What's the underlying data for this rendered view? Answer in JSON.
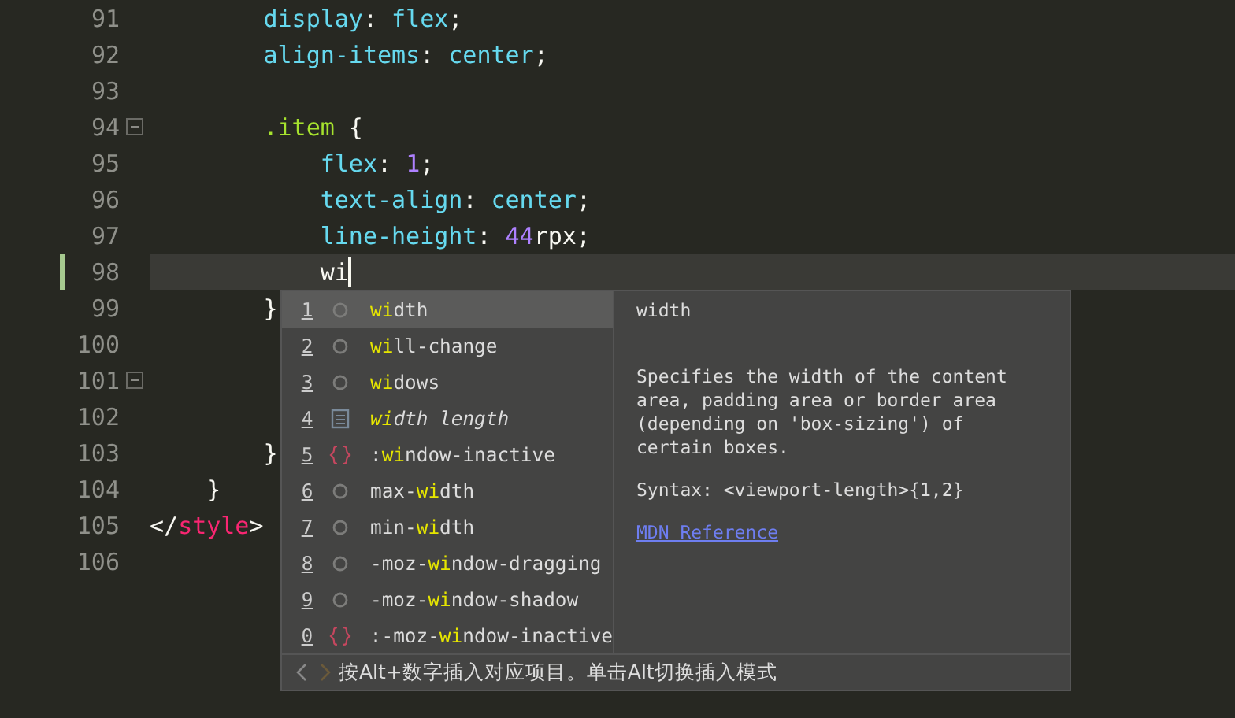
{
  "editor": {
    "lines": [
      {
        "number": "91",
        "fold": false,
        "current": false,
        "tokens": [
          {
            "text": "        display",
            "kind": "property"
          },
          {
            "text": ": ",
            "kind": "plain"
          },
          {
            "text": "flex",
            "kind": "value"
          },
          {
            "text": ";",
            "kind": "plain"
          }
        ]
      },
      {
        "number": "92",
        "fold": false,
        "current": false,
        "tokens": [
          {
            "text": "        align-items",
            "kind": "property"
          },
          {
            "text": ": ",
            "kind": "plain"
          },
          {
            "text": "center",
            "kind": "value"
          },
          {
            "text": ";",
            "kind": "plain"
          }
        ]
      },
      {
        "number": "93",
        "fold": false,
        "current": false
      },
      {
        "number": "94",
        "fold": true,
        "current": false,
        "tokens": [
          {
            "text": "        .item",
            "kind": "selector"
          },
          {
            "text": " {",
            "kind": "plain"
          }
        ]
      },
      {
        "number": "95",
        "fold": false,
        "current": false,
        "tokens": [
          {
            "text": "            flex",
            "kind": "property"
          },
          {
            "text": ": ",
            "kind": "plain"
          },
          {
            "text": "1",
            "kind": "number"
          },
          {
            "text": ";",
            "kind": "plain"
          }
        ]
      },
      {
        "number": "96",
        "fold": false,
        "current": false,
        "tokens": [
          {
            "text": "            text-align",
            "kind": "property"
          },
          {
            "text": ": ",
            "kind": "plain"
          },
          {
            "text": "center",
            "kind": "value"
          },
          {
            "text": ";",
            "kind": "plain"
          }
        ]
      },
      {
        "number": "97",
        "fold": false,
        "current": false,
        "tokens": [
          {
            "text": "            line-height",
            "kind": "property"
          },
          {
            "text": ": ",
            "kind": "plain"
          },
          {
            "text": "44",
            "kind": "number"
          },
          {
            "text": "rpx;",
            "kind": "plain"
          }
        ]
      },
      {
        "number": "98",
        "fold": false,
        "current": true,
        "tokens": [
          {
            "text": "            wi",
            "kind": "plain"
          }
        ]
      },
      {
        "number": "99",
        "fold": false,
        "current": false,
        "tokens": [
          {
            "text": "        }",
            "kind": "plain"
          }
        ]
      },
      {
        "number": "100",
        "fold": false,
        "current": false
      },
      {
        "number": "101",
        "fold": true,
        "current": false
      },
      {
        "number": "102",
        "fold": false,
        "current": false
      },
      {
        "number": "103",
        "fold": false,
        "current": false,
        "tokens": [
          {
            "text": "        }",
            "kind": "plain"
          }
        ]
      },
      {
        "number": "104",
        "fold": false,
        "current": false,
        "tokens": [
          {
            "text": "    }",
            "kind": "plain"
          }
        ]
      },
      {
        "number": "105",
        "fold": false,
        "current": false,
        "tokens": [
          {
            "text": "</",
            "kind": "plain"
          },
          {
            "text": "style",
            "kind": "tag"
          },
          {
            "text": ">",
            "kind": "plain"
          }
        ]
      },
      {
        "number": "106",
        "fold": false,
        "current": false
      }
    ]
  },
  "suggest": {
    "items": [
      {
        "number": "1",
        "kind": "property",
        "selected": true,
        "parts": [
          {
            "text": "wi",
            "match": true
          },
          {
            "text": "dth",
            "match": false
          }
        ]
      },
      {
        "number": "2",
        "kind": "property",
        "selected": false,
        "parts": [
          {
            "text": "wi",
            "match": true
          },
          {
            "text": "ll-change",
            "match": false
          }
        ]
      },
      {
        "number": "3",
        "kind": "property",
        "selected": false,
        "parts": [
          {
            "text": "wi",
            "match": true
          },
          {
            "text": "dows",
            "match": false
          }
        ]
      },
      {
        "number": "4",
        "kind": "snippet",
        "selected": false,
        "parts": [
          {
            "text": "wi",
            "match": true
          },
          {
            "text": "dth length",
            "match": false
          }
        ]
      },
      {
        "number": "5",
        "kind": "selector",
        "selected": false,
        "parts": [
          {
            "text": ":",
            "match": false
          },
          {
            "text": "wi",
            "match": true
          },
          {
            "text": "ndow-inactive",
            "match": false
          }
        ]
      },
      {
        "number": "6",
        "kind": "property",
        "selected": false,
        "parts": [
          {
            "text": "max-",
            "match": false
          },
          {
            "text": "wi",
            "match": true
          },
          {
            "text": "dth",
            "match": false
          }
        ]
      },
      {
        "number": "7",
        "kind": "property",
        "selected": false,
        "parts": [
          {
            "text": "min-",
            "match": false
          },
          {
            "text": "wi",
            "match": true
          },
          {
            "text": "dth",
            "match": false
          }
        ]
      },
      {
        "number": "8",
        "kind": "property",
        "selected": false,
        "parts": [
          {
            "text": "-moz-",
            "match": false
          },
          {
            "text": "wi",
            "match": true
          },
          {
            "text": "ndow-dragging",
            "match": false
          }
        ]
      },
      {
        "number": "9",
        "kind": "property",
        "selected": false,
        "parts": [
          {
            "text": "-moz-",
            "match": false
          },
          {
            "text": "wi",
            "match": true
          },
          {
            "text": "ndow-shadow",
            "match": false
          }
        ]
      },
      {
        "number": "0",
        "kind": "selector",
        "selected": false,
        "parts": [
          {
            "text": ":-moz-",
            "match": false
          },
          {
            "text": "wi",
            "match": true
          },
          {
            "text": "ndow-inactive",
            "match": false
          }
        ]
      }
    ],
    "detail": {
      "title": "width",
      "description": "Specifies the width of the content area, padding area or border area (depending on 'box-sizing') of certain boxes.",
      "syntax": "Syntax: <viewport-length>{1,2}",
      "link": "MDN Reference"
    },
    "footer": "按Alt+数字插入对应项目。单击Alt切换插入模式"
  }
}
